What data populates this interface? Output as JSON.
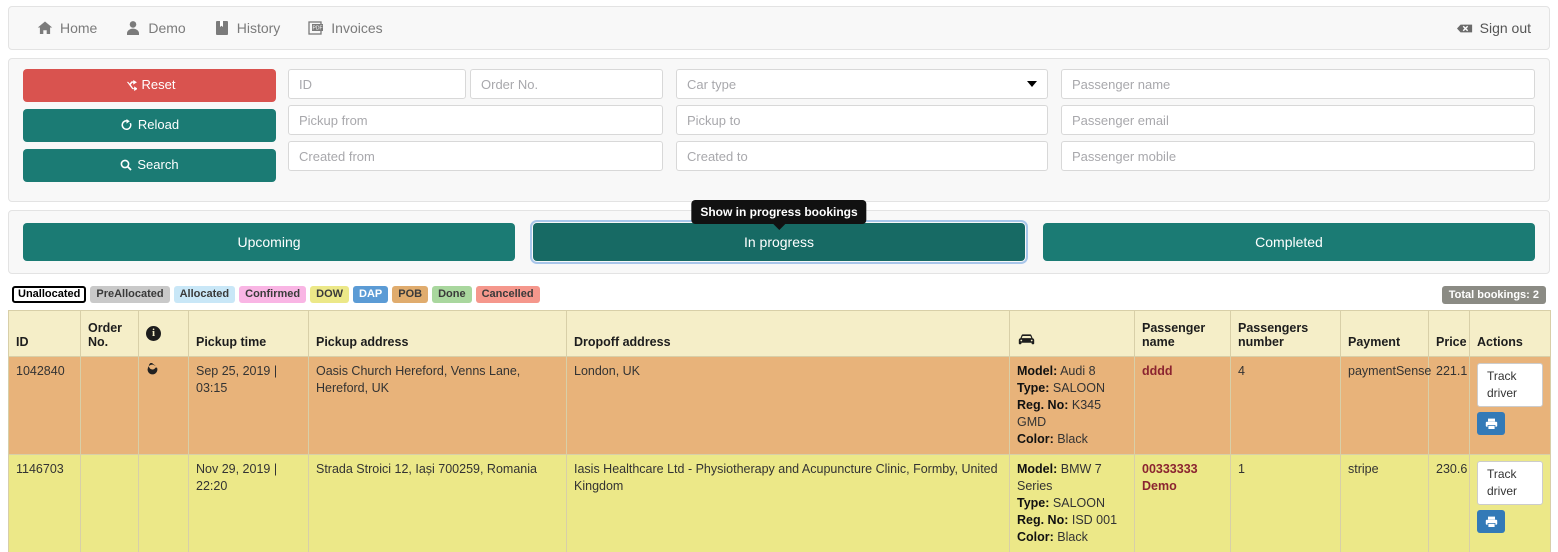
{
  "navbar": {
    "items": [
      {
        "label": "Home",
        "icon": "home-icon"
      },
      {
        "label": "Demo",
        "icon": "user-icon"
      },
      {
        "label": "History",
        "icon": "book-icon"
      },
      {
        "label": "Invoices",
        "icon": "pdf-icon"
      }
    ],
    "signout": {
      "label": "Sign out",
      "icon": "sign-out-icon"
    }
  },
  "filters": {
    "buttons": {
      "reset": "Reset",
      "reload": "Reload",
      "search": "Search"
    },
    "fields": {
      "id": {
        "placeholder": "ID",
        "value": ""
      },
      "order_no": {
        "placeholder": "Order No.",
        "value": ""
      },
      "pickup_from": {
        "placeholder": "Pickup from",
        "value": ""
      },
      "created_from": {
        "placeholder": "Created from",
        "value": ""
      },
      "car_type": {
        "placeholder": "Car type",
        "value": ""
      },
      "pickup_to": {
        "placeholder": "Pickup to",
        "value": ""
      },
      "created_to": {
        "placeholder": "Created to",
        "value": ""
      },
      "passenger_name": {
        "placeholder": "Passenger name",
        "value": ""
      },
      "passenger_email": {
        "placeholder": "Passenger email",
        "value": ""
      },
      "passenger_mobile": {
        "placeholder": "Passenger mobile",
        "value": ""
      }
    }
  },
  "tabs": {
    "upcoming": "Upcoming",
    "in_progress": "In progress",
    "completed": "Completed",
    "tooltip": "Show in progress bookings",
    "active": "In progress"
  },
  "legend": {
    "items": [
      {
        "label": "Unallocated",
        "color": "#ffffff",
        "selected": true
      },
      {
        "label": "PreAllocated",
        "color": "#c9c9c9",
        "selected": false
      },
      {
        "label": "Allocated",
        "color": "#c9e7f7",
        "selected": false
      },
      {
        "label": "Confirmed",
        "color": "#f9b5e4",
        "selected": false
      },
      {
        "label": "DOW",
        "color": "#ece888",
        "selected": false
      },
      {
        "label": "DAP",
        "color": "#5b9bd5",
        "selected": false
      },
      {
        "label": "POB",
        "color": "#e0ac6e",
        "selected": false
      },
      {
        "label": "Done",
        "color": "#a9d79e",
        "selected": false
      },
      {
        "label": "Cancelled",
        "color": "#f5978c",
        "selected": false
      }
    ],
    "total_badge": "Total bookings: 2"
  },
  "table": {
    "headers": {
      "id": "ID",
      "order_no": "Order No.",
      "info": "info-icon",
      "pickup_time": "Pickup time",
      "pickup_address": "Pickup address",
      "dropoff_address": "Dropoff address",
      "car": "car-icon",
      "passenger_name": "Passenger name",
      "passengers_number": "Passengers number",
      "payment": "Payment",
      "price": "Price",
      "actions": "Actions"
    },
    "rows": [
      {
        "status": "POB",
        "id": "1042840",
        "order_no": "",
        "info_icon": "repeat-icon",
        "pickup_time": "Sep 25, 2019 | 03:15",
        "pickup_address": "Oasis Church Hereford, Venns Lane, Hereford, UK",
        "dropoff_address": "London, UK",
        "car": {
          "model_label": "Model:",
          "model": "Audi 8",
          "type_label": "Type:",
          "type": "SALOON",
          "reg_label": "Reg. No:",
          "reg": "K345 GMD",
          "color_label": "Color:",
          "color": "Black"
        },
        "passenger_name": "dddd",
        "passengers_number": "4",
        "payment": "paymentSense",
        "price": "221.1",
        "actions": {
          "track": "Track driver",
          "print": "print-icon"
        }
      },
      {
        "status": "DOW",
        "id": "1146703",
        "order_no": "",
        "info_icon": "",
        "pickup_time": "Nov 29, 2019 | 22:20",
        "pickup_address": "Strada Stroici 12, Iași 700259, Romania",
        "dropoff_address": "Iasis Healthcare Ltd - Physiotherapy and Acupuncture Clinic, Formby, United Kingdom",
        "car": {
          "model_label": "Model:",
          "model": "BMW 7 Series",
          "type_label": "Type:",
          "type": "SALOON",
          "reg_label": "Reg. No:",
          "reg": "ISD 001",
          "color_label": "Color:",
          "color": "Black"
        },
        "passenger_name": "00333333 Demo",
        "passengers_number": "1",
        "payment": "stripe",
        "price": "230.6",
        "actions": {
          "track": "Track driver",
          "print": "print-icon"
        }
      }
    ]
  }
}
